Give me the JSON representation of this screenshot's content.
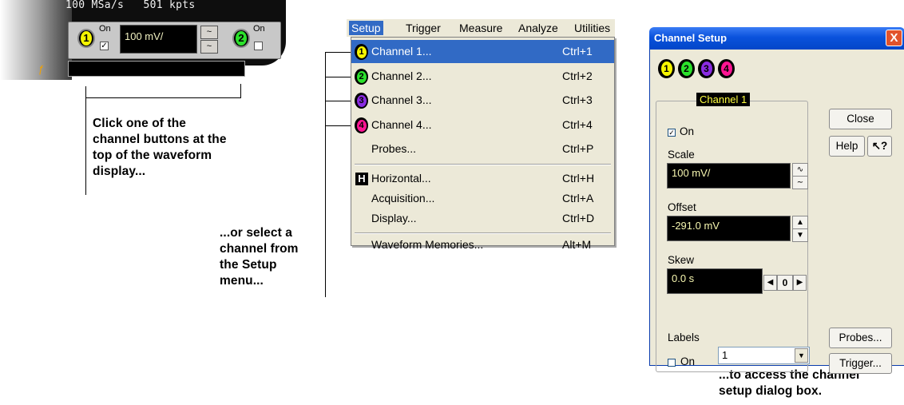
{
  "colors": {
    "ch1": "#f5f500",
    "ch2": "#2be12b",
    "ch3": "#8a2be2",
    "ch4": "#ff1493",
    "menu_highlight": "#316ac5",
    "title_blue": "#0a52dc"
  },
  "scope": {
    "sample_rate": "100 MSa/s",
    "points": "501 kpts",
    "ch1_num": "1",
    "ch2_num": "2",
    "ch1_on_label": "On",
    "ch2_on_label": "On",
    "ch1_on_checked": true,
    "ch2_on_checked": false,
    "scale_value": "100 mV/",
    "spin_up_icon": "~",
    "spin_down_icon": "~"
  },
  "annotations": {
    "left_note": [
      "Click one of the",
      "channel buttons at the",
      "top of the waveform",
      "display..."
    ],
    "middle_note": [
      "...or select a",
      "channel from",
      "the Setup",
      "menu..."
    ],
    "right_note": [
      "...to access the channel",
      "setup dialog box."
    ]
  },
  "menu": {
    "bar": [
      "Setup",
      "Trigger",
      "Measure",
      "Analyze",
      "Utilities"
    ],
    "items": [
      {
        "icon": "1",
        "label": "Channel 1...",
        "shortcut": "Ctrl+1",
        "highlighted": true
      },
      {
        "icon": "2",
        "label": "Channel 2...",
        "shortcut": "Ctrl+2"
      },
      {
        "icon": "3",
        "label": "Channel 3...",
        "shortcut": "Ctrl+3"
      },
      {
        "icon": "4",
        "label": "Channel 4...",
        "shortcut": "Ctrl+4"
      },
      {
        "icon": "",
        "label": "Probes...",
        "shortcut": "Ctrl+P"
      },
      {
        "icon": "H",
        "label": "Horizontal...",
        "shortcut": "Ctrl+H"
      },
      {
        "icon": "",
        "label": "Acquisition...",
        "shortcut": "Ctrl+A"
      },
      {
        "icon": "",
        "label": "Display...",
        "shortcut": "Ctrl+D"
      },
      {
        "icon": "",
        "label": "Waveform Memories...",
        "shortcut": "Alt+M"
      }
    ]
  },
  "dialog": {
    "title": "Channel Setup",
    "close_x": "X",
    "channels": [
      "1",
      "2",
      "3",
      "4"
    ],
    "group_title": "Channel 1",
    "on_label": "On",
    "on_checked": true,
    "scale_label": "Scale",
    "scale_value": "100 mV/",
    "offset_label": "Offset",
    "offset_value": "-291.0 mV",
    "skew_label": "Skew",
    "skew_value": "0.0 s",
    "skew_zero": "0",
    "labels_label": "Labels",
    "labels_on_label": "On",
    "labels_on_checked": false,
    "labels_value": "1",
    "close_button": "Close",
    "help_button": "Help",
    "whats_this_icon": "?",
    "probes_button": "Probes...",
    "trigger_button": "Trigger..."
  }
}
